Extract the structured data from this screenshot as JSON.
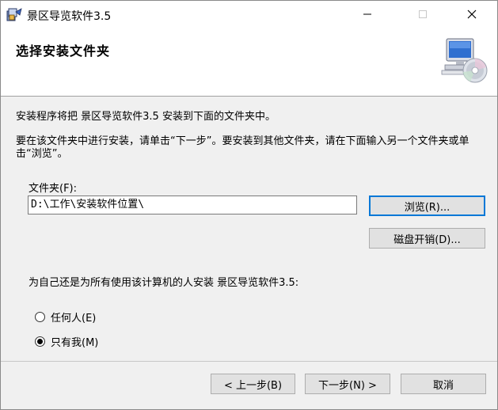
{
  "window": {
    "title": "景区导览软件3.5"
  },
  "titlebar_buttons": {
    "minimize": "minimize-icon",
    "maximize": "maximize-icon",
    "close": "close-icon"
  },
  "header": {
    "title": "选择安装文件夹",
    "graphic": "computer-cd-icon"
  },
  "content": {
    "description_1": "安装程序将把 景区导览软件3.5 安装到下面的文件夹中。",
    "description_2": "要在该文件夹中进行安装，请单击“下一步”。要安装到其他文件夹，请在下面输入另一个文件夹或单击“浏览”。",
    "folder_label": "文件夹(F):",
    "folder_value": "D:\\工作\\安装软件位置\\",
    "browse_button": "浏览(R)...",
    "disk_cost_button": "磁盘开销(D)...",
    "install_for_label": "为自己还是为所有使用该计算机的人安装 景区导览软件3.5:",
    "radio_options": [
      {
        "label": "任何人(E)",
        "checked": false
      },
      {
        "label": "只有我(M)",
        "checked": true
      }
    ]
  },
  "footer": {
    "back_button": "< 上一步(B)",
    "next_button": "下一步(N) >",
    "cancel_button": "取消"
  },
  "colors": {
    "focus_border": "#0078d7",
    "window_bg": "#f0f0f0",
    "header_bg": "#ffffff"
  }
}
